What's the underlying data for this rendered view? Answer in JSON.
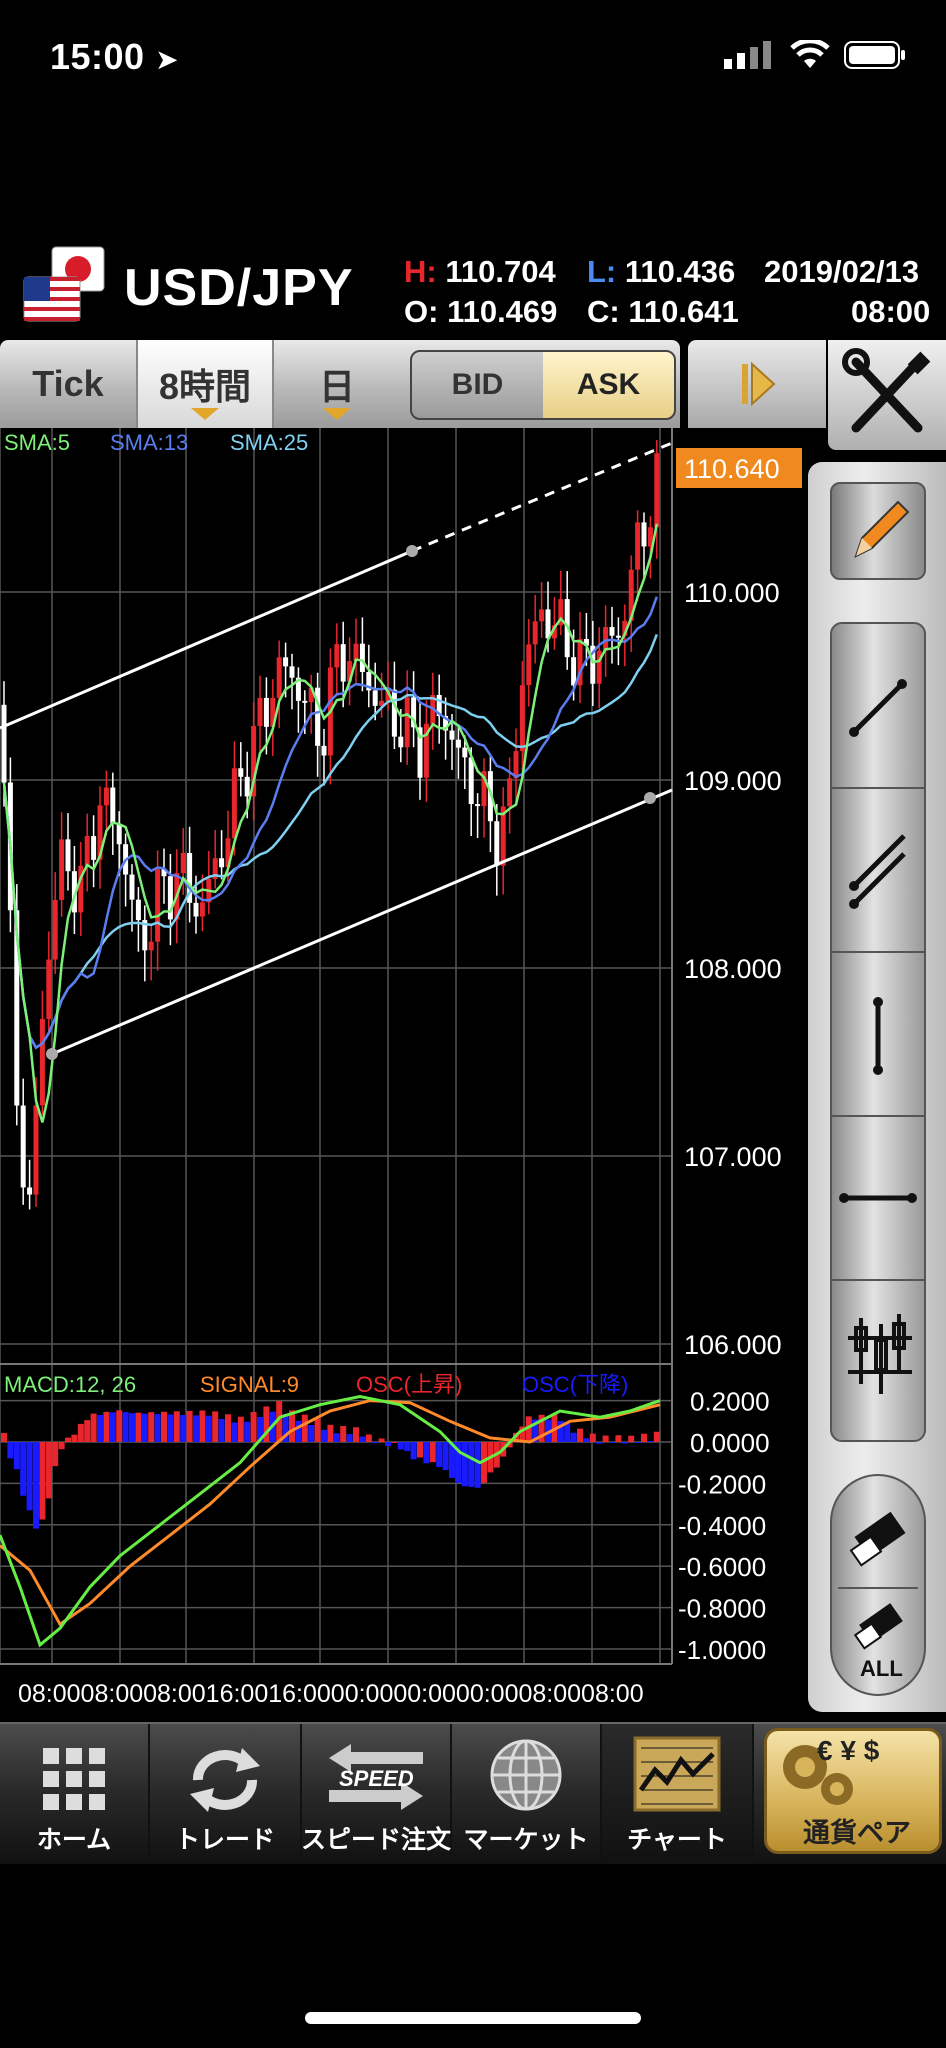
{
  "status_bar": {
    "time": "15:00"
  },
  "header": {
    "pair": "USD/JPY",
    "high_label": "H:",
    "high": "110.704",
    "low_label": "L:",
    "low": "110.436",
    "open_label": "O:",
    "open": "110.469",
    "close_label": "C:",
    "close": "110.641",
    "date": "2019/02/13",
    "time": "08:00"
  },
  "tabs": [
    {
      "label": "Tick",
      "selected": false
    },
    {
      "label": "8時間",
      "selected": true
    },
    {
      "label": "日",
      "selected": false
    }
  ],
  "bidask": {
    "bid": "BID",
    "ask": "ASK",
    "selected": "ASK"
  },
  "chart": {
    "sma_labels": {
      "sma5": "SMA:5",
      "sma13": "SMA:13",
      "sma25": "SMA:25"
    },
    "current_price": "110.640",
    "price_ticks": [
      "110.000",
      "109.000",
      "108.000",
      "107.000",
      "106.000"
    ],
    "macd_labels": {
      "macd": "MACD:12, 26",
      "signal": "SIGNAL:9",
      "osc_up": "OSC(上昇)",
      "osc_down": "OSC(下降)"
    },
    "macd_ticks": [
      "0.2000",
      "0.0000",
      "-0.2000",
      "-0.4000",
      "-0.6000",
      "-0.8000",
      "-1.0000"
    ],
    "time_axis": "08:0008:0008:0016:0016:0000:0000:0000:0008:0008:00"
  },
  "colors": {
    "sma5": "#7ef07a",
    "sma13": "#5a7ef0",
    "sma25": "#7fd0f0",
    "bull": "#e8262b",
    "bear": "#ffffff",
    "macd": "#66ee44",
    "signal": "#ff8a2a",
    "osc_up": "#e8262b",
    "osc_down": "#1a1aff",
    "accent": "#f08a1e"
  },
  "nav": [
    {
      "label": "ホーム",
      "icon": "grid-icon"
    },
    {
      "label": "トレード",
      "icon": "refresh-icon"
    },
    {
      "label": "スピード注文",
      "icon": "speed-icon"
    },
    {
      "label": "マーケット",
      "icon": "globe-icon"
    },
    {
      "label": "チャート",
      "icon": "chart-icon",
      "active": true
    }
  ],
  "pair_button": {
    "label": "通貨ペア",
    "symbols": "€ ¥ $"
  },
  "speed_badge": "SPEED",
  "eraser_all": "ALL"
}
